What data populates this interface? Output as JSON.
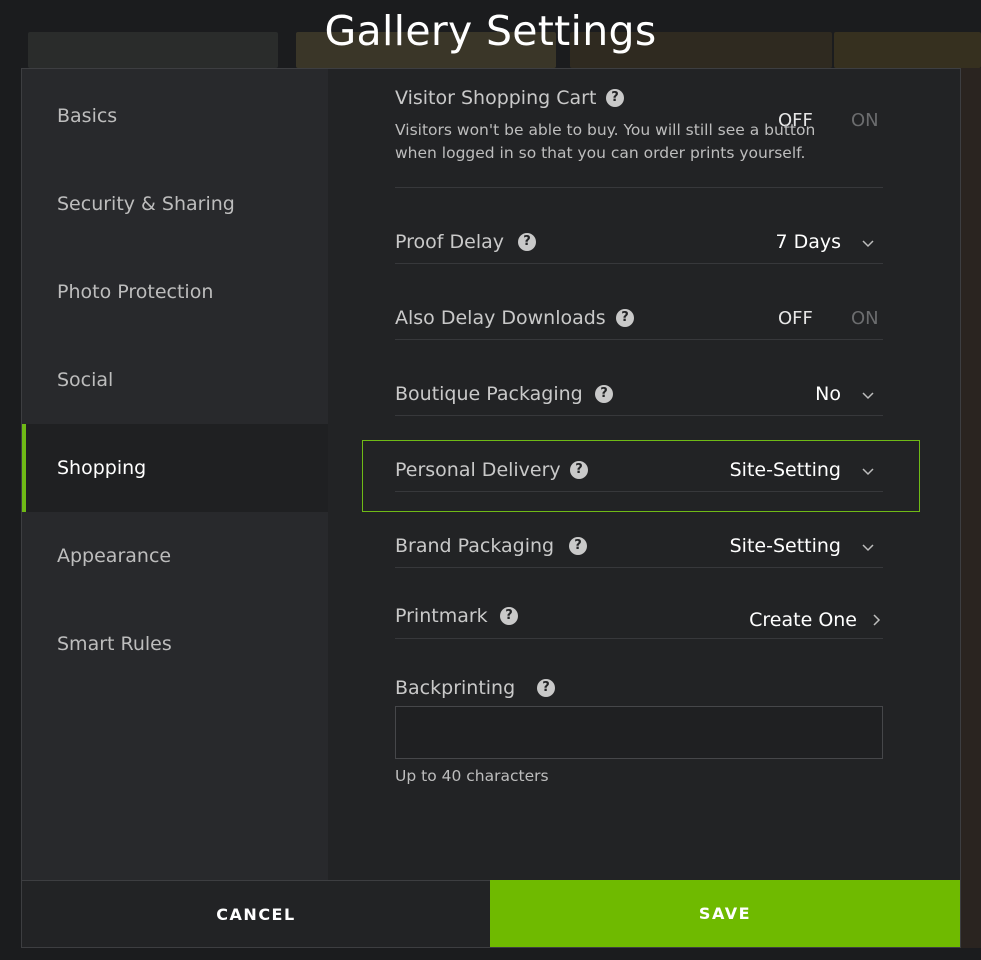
{
  "window": {
    "title": "Gallery Settings"
  },
  "sidebar": {
    "items": [
      {
        "label": "Basics"
      },
      {
        "label": "Security & Sharing"
      },
      {
        "label": "Photo Protection"
      },
      {
        "label": "Social"
      },
      {
        "label": "Shopping",
        "active": true
      },
      {
        "label": "Appearance"
      },
      {
        "label": "Smart Rules"
      }
    ]
  },
  "settings": {
    "visitor_cart": {
      "label": "Visitor Shopping Cart",
      "off": "OFF",
      "on": "ON",
      "selected": "OFF",
      "description": "Visitors won't be able to buy. You will still see a button when logged in so that you can order prints yourself."
    },
    "proof_delay": {
      "label": "Proof Delay",
      "value": "7 Days"
    },
    "delay_downloads": {
      "label": "Also Delay Downloads",
      "off": "OFF",
      "on": "ON",
      "selected": "OFF"
    },
    "boutique_packaging": {
      "label": "Boutique Packaging",
      "value": "No"
    },
    "personal_delivery": {
      "label": "Personal Delivery",
      "value": "Site-Setting"
    },
    "brand_packaging": {
      "label": "Brand Packaging",
      "value": "Site-Setting"
    },
    "printmark": {
      "label": "Printmark",
      "value": "Create One"
    },
    "backprinting": {
      "label": "Backprinting",
      "value": "",
      "hint": "Up to 40 characters"
    }
  },
  "icons": {
    "help": "?",
    "help_icon": "question-circle-icon",
    "dropdown_icon": "chevron-down-icon",
    "link_icon": "chevron-right-icon"
  },
  "footer": {
    "cancel_label": "CANCEL",
    "save_label": "SAVE"
  },
  "colors": {
    "accent": "#6fba00",
    "background": "#222325",
    "sidebar": "#28292c"
  }
}
